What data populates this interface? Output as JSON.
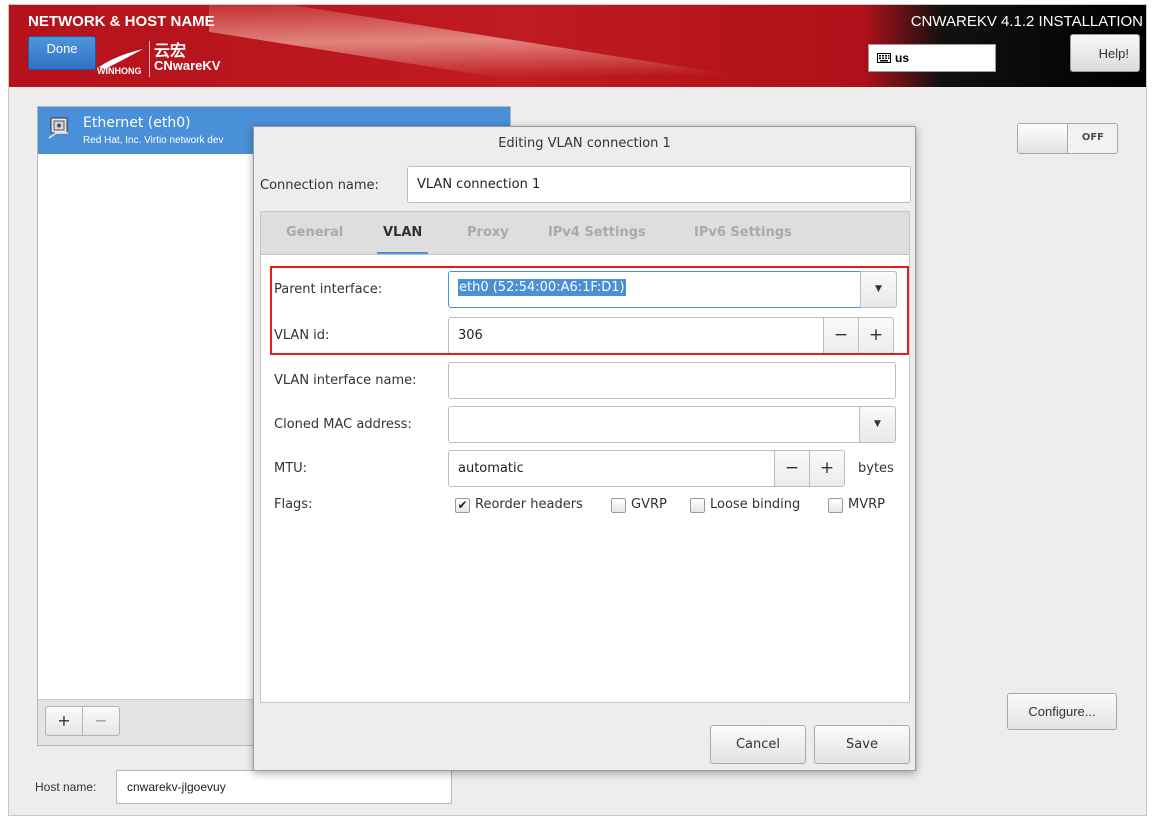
{
  "header": {
    "title": "NETWORK & HOST NAME",
    "done_label": "Done",
    "logo_cn": "云宏",
    "logo_en": "CNwareKV",
    "logo_sub": "WINHONG",
    "product_title": "CNWAREKV 4.1.2 INSTALLATION",
    "keyboard_layout": "us",
    "help_label": "Help!"
  },
  "devices": {
    "items": [
      {
        "name": "Ethernet (eth0)",
        "description": "Red Hat, Inc. Virtio network dev"
      }
    ],
    "add_label": "+",
    "remove_label": "−"
  },
  "device_toggle": {
    "state_label": "OFF"
  },
  "configure_label": "Configure...",
  "host": {
    "label": "Host name:",
    "value": "cnwarekv-jlgoevuy"
  },
  "dialog": {
    "title": "Editing VLAN connection 1",
    "connection_name_label": "Connection name:",
    "connection_name_value": "VLAN connection 1",
    "tabs": [
      {
        "label": "General",
        "active": false
      },
      {
        "label": "VLAN",
        "active": true
      },
      {
        "label": "Proxy",
        "active": false
      },
      {
        "label": "IPv4 Settings",
        "active": false
      },
      {
        "label": "IPv6 Settings",
        "active": false
      }
    ],
    "vlan": {
      "parent_interface_label": "Parent interface:",
      "parent_interface_value": "eth0 (52:54:00:A6:1F:D1)",
      "vlan_id_label": "VLAN id:",
      "vlan_id_value": "306",
      "interface_name_label": "VLAN interface name:",
      "interface_name_value": "",
      "cloned_mac_label": "Cloned MAC address:",
      "cloned_mac_value": "",
      "mtu_label": "MTU:",
      "mtu_value": "automatic",
      "mtu_unit": "bytes",
      "flags_label": "Flags:",
      "flags": [
        {
          "label": "Reorder headers",
          "checked": true
        },
        {
          "label": "GVRP",
          "checked": false
        },
        {
          "label": "Loose binding",
          "checked": false
        },
        {
          "label": "MVRP",
          "checked": false
        }
      ],
      "minus": "−",
      "plus": "+"
    },
    "cancel_label": "Cancel",
    "save_label": "Save"
  },
  "colors": {
    "header_red": "#b5121b",
    "accent_blue": "#4a90d9",
    "highlight_red": "#e02020"
  }
}
